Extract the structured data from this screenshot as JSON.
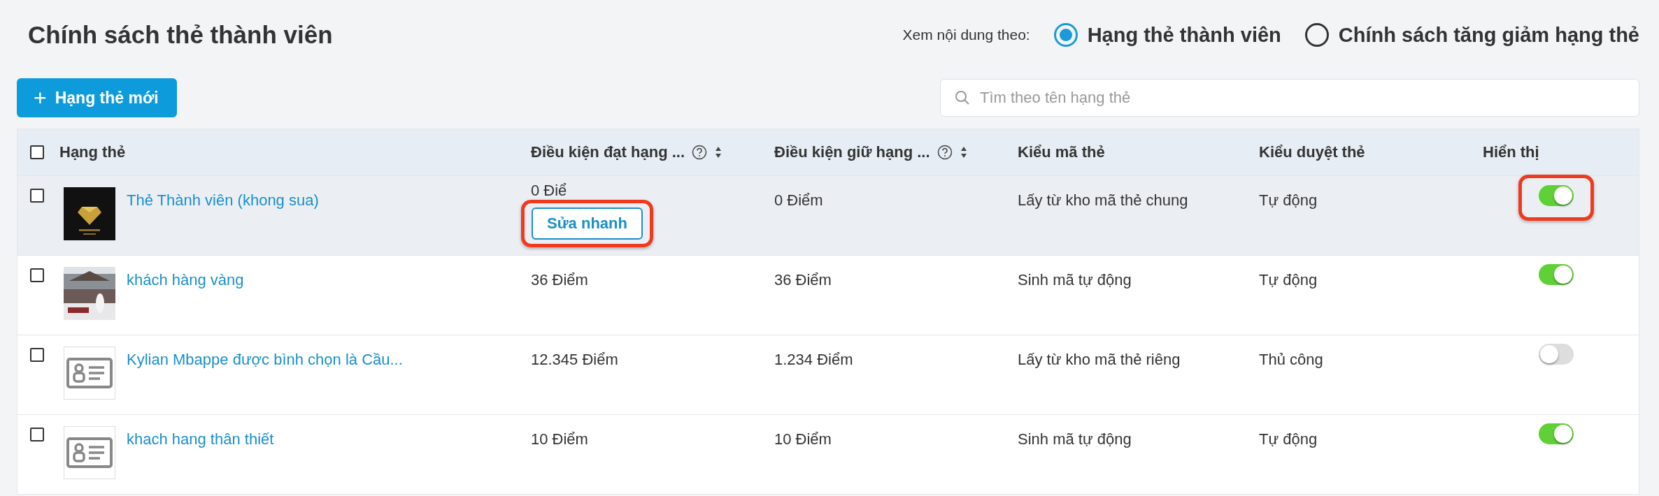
{
  "title": "Chính sách thẻ thành viên",
  "view_by": {
    "label": "Xem nội dung theo:",
    "options": [
      {
        "label": "Hạng thẻ thành viên",
        "selected": true
      },
      {
        "label": "Chính sách tăng giảm hạng thẻ",
        "selected": false
      }
    ]
  },
  "new_button": {
    "icon": "+",
    "label": "Hạng thẻ mới"
  },
  "search": {
    "placeholder": "Tìm theo tên hạng thẻ"
  },
  "table": {
    "select_all_checked": false,
    "columns": [
      {
        "label": "Hạng thẻ",
        "help": false,
        "sortable": false
      },
      {
        "label": "Điều kiện đạt hạng ...",
        "help": true,
        "sortable": true
      },
      {
        "label": "Điều kiện giữ hạng ...",
        "help": true,
        "sortable": true
      },
      {
        "label": "Kiểu mã thẻ",
        "help": false,
        "sortable": false
      },
      {
        "label": "Kiểu duyệt thẻ",
        "help": false,
        "sortable": false
      },
      {
        "label": "Hiển thị",
        "help": false,
        "sortable": false
      }
    ],
    "rows": [
      {
        "checked": false,
        "hovered": true,
        "kind": "picture",
        "name": "Thẻ Thành viên (khong sua)",
        "reach": "0 Điể",
        "quick_edit": {
          "label": "Sửa nhanh",
          "highlighted": true
        },
        "keep": "0 Điểm",
        "code_type": "Lấy từ kho mã thẻ chung",
        "approval": "Tự động",
        "visible": true,
        "visible_highlighted": true
      },
      {
        "checked": false,
        "hovered": false,
        "kind": "picture",
        "name": "khách hàng vàng",
        "reach": "36 Điểm",
        "keep": "36 Điểm",
        "code_type": "Sinh mã tự động",
        "approval": "Tự động",
        "visible": true,
        "visible_highlighted": false
      },
      {
        "checked": false,
        "hovered": false,
        "kind": "placeholder",
        "name": "Kylian Mbappe được bình chọn là Cầu...",
        "reach": "12.345 Điểm",
        "keep": "1.234 Điểm",
        "code_type": "Lấy từ kho mã thẻ riêng",
        "approval": "Thủ công",
        "visible": false,
        "visible_highlighted": false
      },
      {
        "checked": false,
        "hovered": false,
        "kind": "placeholder",
        "name": "khach hang thân thiết",
        "reach": "10 Điểm",
        "keep": "10 Điểm",
        "code_type": "Sinh mã tự động",
        "approval": "Tự động",
        "visible": true,
        "visible_highlighted": false
      }
    ]
  }
}
